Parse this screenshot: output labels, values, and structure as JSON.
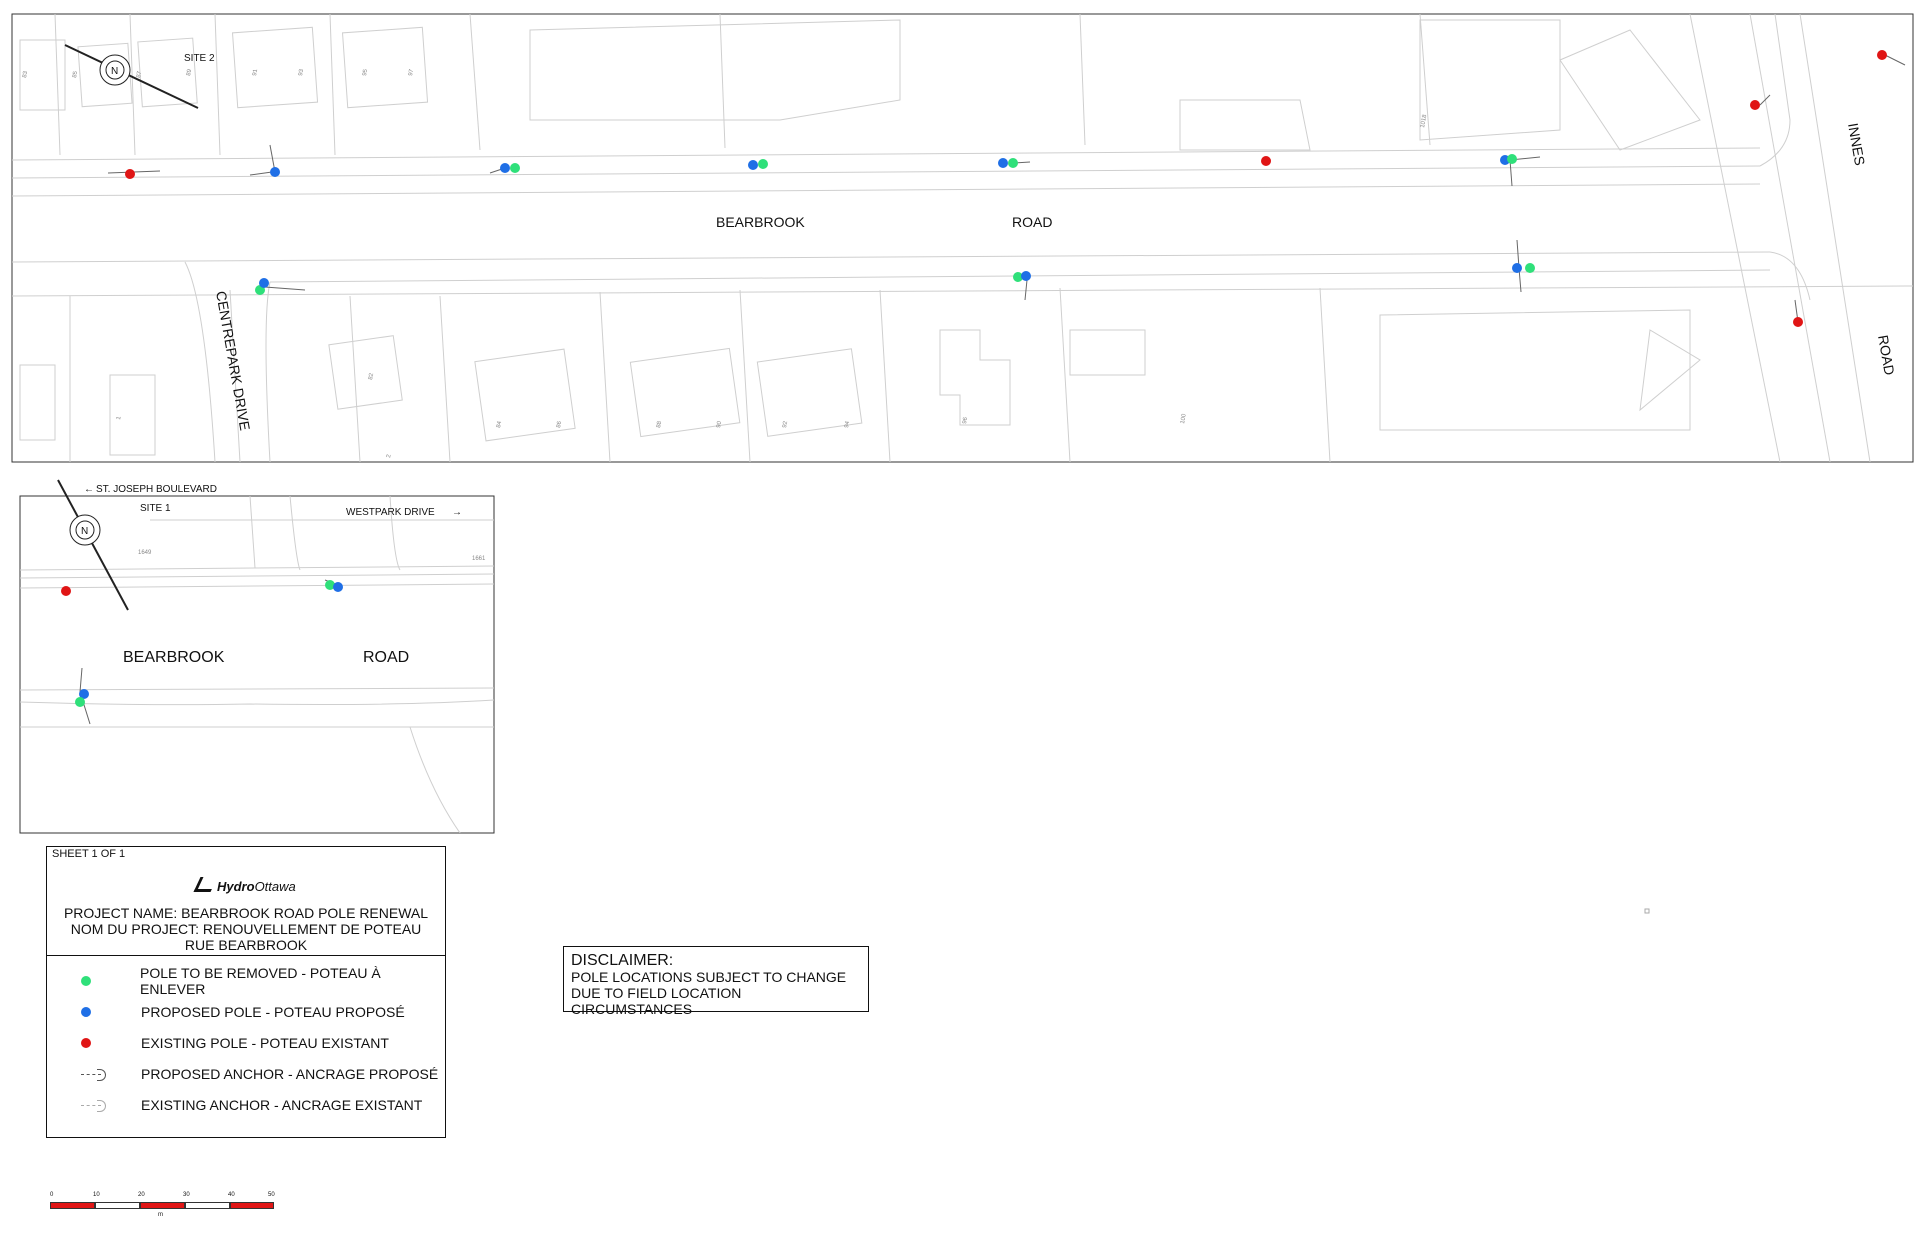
{
  "colors": {
    "pole_to_remove": "#2fe07a",
    "proposed_pole": "#1f6fe6",
    "existing_pole": "#e01515",
    "scale_red": "#e01515"
  },
  "site2": {
    "site_label": "SITE 2",
    "north_icon": "north-arrow-icon",
    "streets": {
      "bearbrook": "BEARBROOK",
      "road": "ROAD",
      "centrepark": "CENTREPARK DRIVE",
      "innes": "INNES",
      "innes_road": "ROAD"
    },
    "lot_numbers": [
      "83",
      "85",
      "87",
      "89",
      "91",
      "93",
      "95",
      "97",
      "1018",
      "82",
      "84",
      "86",
      "88",
      "90",
      "92",
      "94",
      "96",
      "100",
      "2",
      "1"
    ]
  },
  "site1": {
    "site_label": "SITE 1",
    "north_icon": "north-arrow-icon",
    "st_joseph": "ST. JOSEPH BOULEVARD",
    "westpark": "WESTPARK DRIVE",
    "arrow_left": "←",
    "arrow_right": "→",
    "bearbrook": "BEARBROOK",
    "road": "ROAD",
    "lot_numbers": [
      "1649",
      "1661"
    ]
  },
  "title_block": {
    "sheet": "SHEET 1 OF 1",
    "logo_bold": "Hydro",
    "logo_rest": "Ottawa",
    "project_line1": "PROJECT NAME: BEARBROOK ROAD POLE RENEWAL",
    "project_line2": "NOM DU PROJECT: RENOUVELLEMENT DE POTEAU",
    "project_line3": "RUE BEARBROOK"
  },
  "legend": [
    {
      "symbol": "green-dot-icon",
      "label": "POLE TO BE REMOVED - POTEAU À ENLEVER"
    },
    {
      "symbol": "blue-dot-icon",
      "label": "PROPOSED POLE - POTEAU PROPOSÉ"
    },
    {
      "symbol": "red-dot-icon",
      "label": "EXISTING POLE - POTEAU EXISTANT"
    },
    {
      "symbol": "proposed-anchor-icon",
      "label": "PROPOSED ANCHOR - ANCRAGE PROPOSÉ"
    },
    {
      "symbol": "existing-anchor-icon",
      "label": "EXISTING ANCHOR - ANCRAGE EXISTANT"
    }
  ],
  "disclaimer": {
    "heading": "DISCLAIMER:",
    "line1": "POLE LOCATIONS SUBJECT TO CHANGE",
    "line2": "DUE TO FIELD LOCATION CIRCUMSTANCES"
  },
  "scale": {
    "ticks": [
      "0",
      "10",
      "20",
      "30",
      "40",
      "50"
    ],
    "unit": "m"
  }
}
